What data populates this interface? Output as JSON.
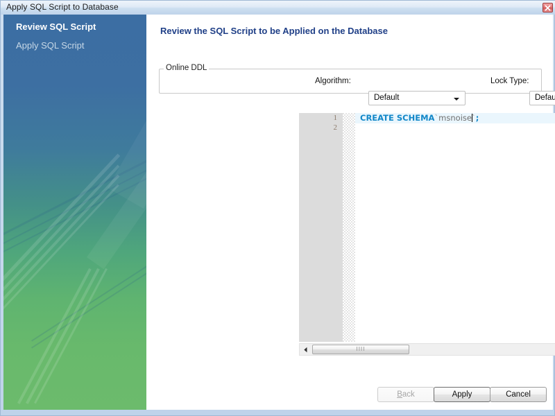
{
  "window": {
    "title": "Apply SQL Script to Database",
    "close_icon": "close-icon"
  },
  "sidebar": {
    "steps": [
      {
        "label": "Review SQL Script",
        "state": "active"
      },
      {
        "label": "Apply SQL Script",
        "state": "pending"
      }
    ],
    "gradient_top": "#3c6ea3",
    "gradient_bottom": "#6cbb6c"
  },
  "content": {
    "page_title": "Review the SQL Script to be Applied on the Database",
    "title_color": "#1f3f87"
  },
  "online_ddl": {
    "legend": "Online DDL",
    "algorithm": {
      "label": "Algorithm:",
      "value": "Default",
      "arrow_icon": "chevron-down-icon"
    },
    "lock_type": {
      "label": "Lock Type:",
      "value": "Default",
      "arrow_icon": "chevron-down-icon"
    }
  },
  "editor": {
    "line_numbers": [
      "1",
      "2"
    ],
    "code": {
      "keyword": "CREATE SCHEMA",
      "backtick_open": "`",
      "identifier": "msnoise",
      "backtick_close": "`",
      "semicolon": ";"
    },
    "keyword_color": "#1287c8",
    "identifier_color": "#6f6f6f",
    "current_line_highlight": "#eaf6fd",
    "gutter_color": "#dcdcdc"
  },
  "scrollbar": {
    "left_arrow_icon": "caret-left-icon",
    "right_arrow_icon": "caret-right-icon",
    "grip_glyph": "IIII"
  },
  "footer": {
    "buttons": [
      {
        "label": "Back",
        "mnemonic": "B",
        "rest": "ack",
        "enabled": false
      },
      {
        "label": "Apply",
        "mnemonic": "",
        "rest": "Apply",
        "enabled": true,
        "default": true
      },
      {
        "label": "Cancel",
        "mnemonic": "",
        "rest": "Cancel",
        "enabled": true
      }
    ]
  }
}
